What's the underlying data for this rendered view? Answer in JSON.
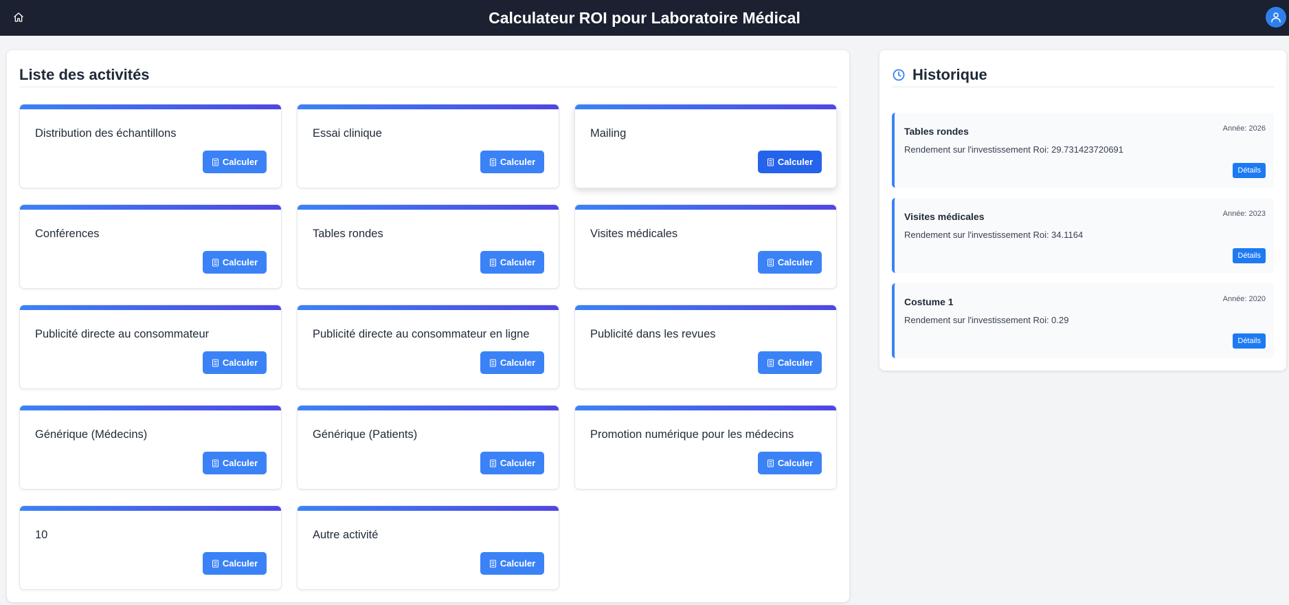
{
  "app": {
    "title": "Calculateur ROI pour Laboratoire Médical"
  },
  "activities": {
    "heading": "Liste des activités",
    "calc_label": "Calculer",
    "items": [
      {
        "label": "Distribution des échantillons"
      },
      {
        "label": "Essai clinique"
      },
      {
        "label": "Mailing"
      },
      {
        "label": "Conférences"
      },
      {
        "label": "Tables rondes"
      },
      {
        "label": "Visites médicales"
      },
      {
        "label": "Publicité directe au consommateur"
      },
      {
        "label": "Publicité directe au consommateur en ligne"
      },
      {
        "label": "Publicité dans les revues"
      },
      {
        "label": "Générique (Médecins)"
      },
      {
        "label": "Générique (Patients)"
      },
      {
        "label": "Promotion numérique pour les médecins"
      },
      {
        "label": "10"
      },
      {
        "label": "Autre activité"
      }
    ]
  },
  "history": {
    "heading": "Historique",
    "details_label": "Détails",
    "items": [
      {
        "title": "Tables rondes",
        "year": "Année: 2026",
        "roi": "Rendement sur l'investissement Roi: 29.731423720691"
      },
      {
        "title": "Visites médicales",
        "year": "Année: 2023",
        "roi": "Rendement sur l'investissement Roi: 34.1164"
      },
      {
        "title": "Costume 1",
        "year": "Année: 2020",
        "roi": "Rendement sur l'investissement Roi: 0.29"
      }
    ]
  },
  "icons": {
    "home": "home-icon",
    "user": "user-icon",
    "clock": "clock-icon",
    "calculator": "calculator-icon"
  },
  "colors": {
    "topbar": "#1b2130",
    "primary": "#3b82f6",
    "primary_active": "#2563eb",
    "gradient_end": "#4f46e5",
    "details": "#1d7af2"
  }
}
